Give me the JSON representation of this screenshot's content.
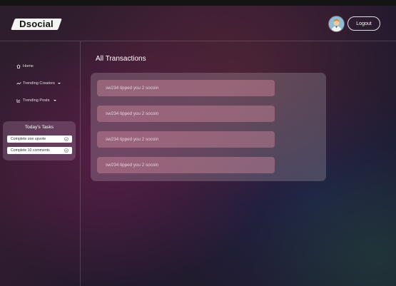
{
  "header": {
    "logo_text": "Dsocial",
    "logout_label": "Logout"
  },
  "sidebar": {
    "items": [
      {
        "label": "Home",
        "icon": "home-icon"
      },
      {
        "label": "Trending Creators",
        "icon": "trend-icon"
      },
      {
        "label": "Trending Posts",
        "icon": "chart-icon"
      }
    ],
    "tasks": {
      "title": "Today's Tasks",
      "items": [
        {
          "label": "Complete one upvote",
          "icon": "check-circle-icon"
        },
        {
          "label": "Complete 10 comments",
          "icon": "check-circle-icon"
        }
      ]
    }
  },
  "main": {
    "title": "All Transactions",
    "transactions": [
      "sw234 tipped you 2 socoin",
      "sw234 tipped you 2 socoin",
      "sw234 tipped you 2 socoin",
      "sw234 tipped you 2 socoin"
    ]
  },
  "colors": {
    "background": "#2c1e2c",
    "transaction_item": "#d78ca0",
    "panel": "#bebac3"
  }
}
